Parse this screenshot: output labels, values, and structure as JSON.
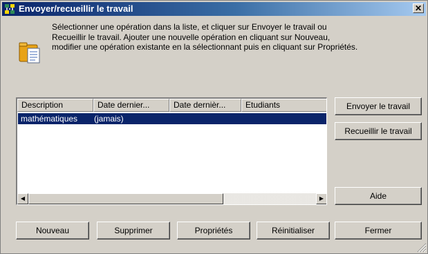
{
  "window": {
    "title": "Envoyer/recueillir le travail",
    "close_glyph": "✕"
  },
  "instructions": {
    "line1": "Sélectionner une opération dans la liste, et cliquer sur Envoyer le travail ou",
    "line2": "Recueillir le travail. Ajouter une nouvelle opération en cliquant sur Nouveau,",
    "line3": "modifier une opération existante en la sélectionnant puis en cliquant sur Propriétés."
  },
  "listview": {
    "columns": [
      "Description",
      "Date dernier...",
      "Date dernièr...",
      "Etudiants"
    ],
    "rows": [
      {
        "description": "mathématiques",
        "date1": "(jamais)",
        "date2": "",
        "students": ""
      }
    ],
    "scroll_left_glyph": "◀",
    "scroll_right_glyph": "▶"
  },
  "buttons": {
    "send": "Envoyer le travail",
    "collect": "Recueillir le travail",
    "help": "Aide",
    "new": "Nouveau",
    "delete": "Supprimer",
    "properties": "Propriétés",
    "reset": "Réinitialiser",
    "close": "Fermer"
  },
  "icons": {
    "app": "network-transfer-icon",
    "info": "folder-document-icon",
    "close": "close-icon",
    "grip": "resize-grip-icon"
  },
  "colors": {
    "titlebar_start": "#0a246a",
    "titlebar_end": "#a6caf0",
    "selection": "#0a246a",
    "face": "#d4d0c8"
  }
}
